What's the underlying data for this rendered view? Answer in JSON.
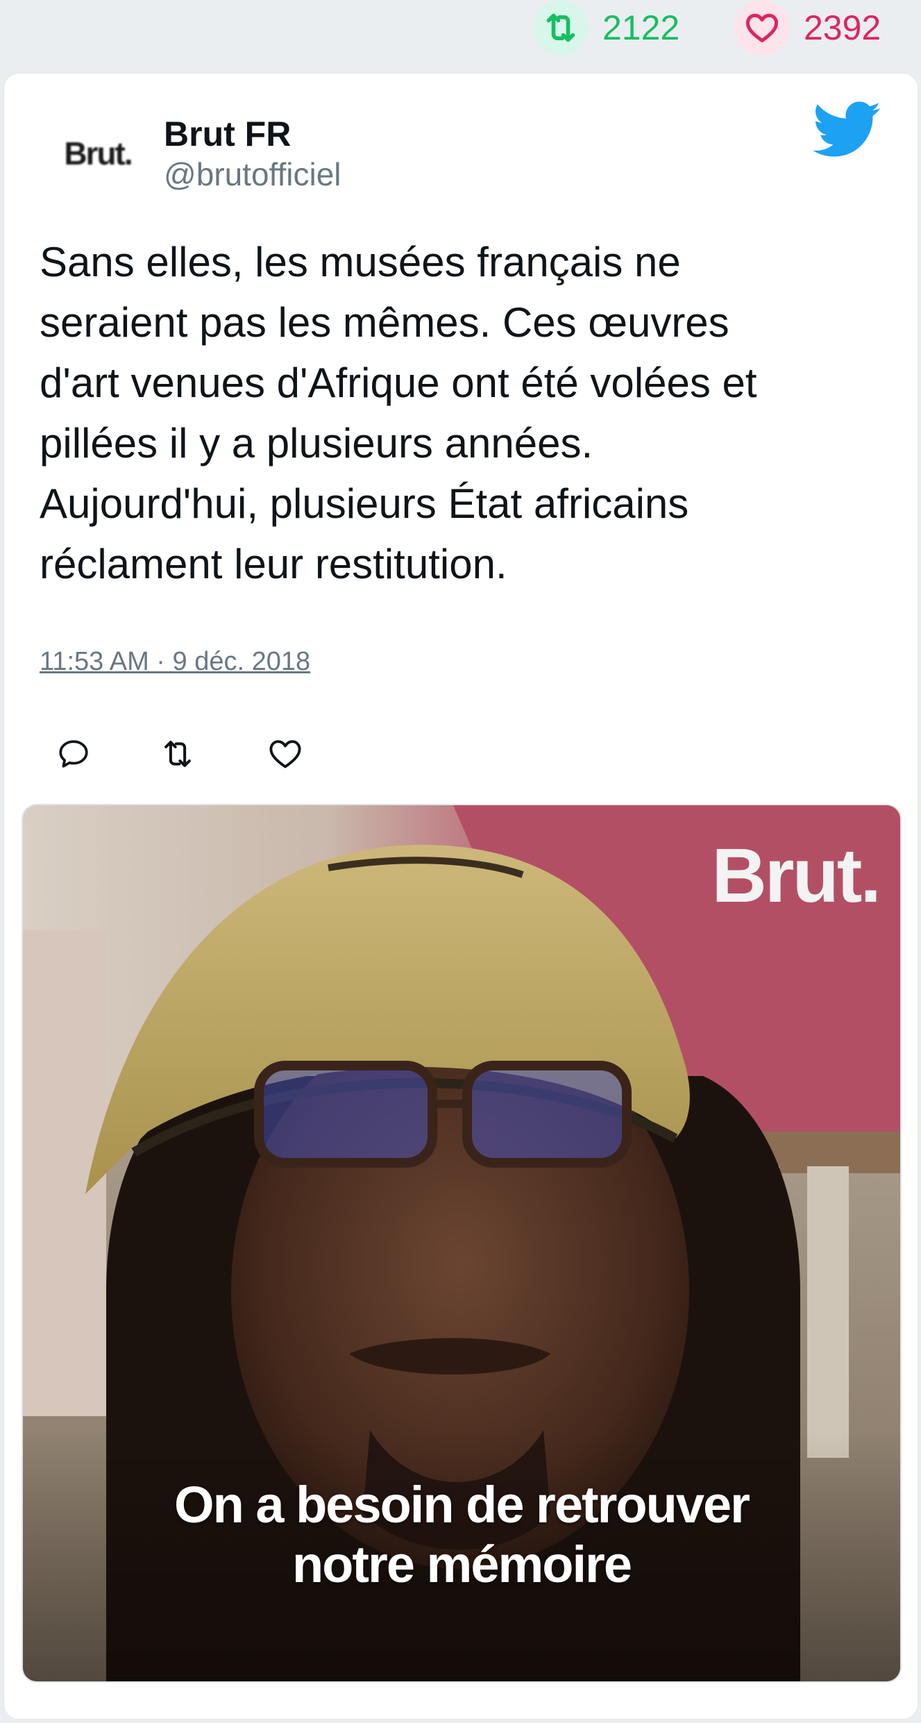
{
  "stats": {
    "retweets": "2122",
    "likes": "2392"
  },
  "tweet": {
    "avatar_text": "Brut.",
    "display_name": "Brut FR",
    "handle": "@brutofficiel",
    "text": "Sans elles, les musées français ne\nseraient pas les mêmes. Ces œuvres\nd'art venues d'Afrique ont été volées et\npillées il y a plusieurs années.\nAujourd'hui, plusieurs État africains\nréclament leur restitution.",
    "timestamp": "11:53 AM · 9 déc. 2018"
  },
  "media": {
    "watermark": "Brut.",
    "caption": "On a besoin de retrouver\nnotre mémoire"
  },
  "icons": {
    "retweet_stat": "retweet-icon",
    "like_stat": "heart-icon",
    "brand": "twitter-bird-icon",
    "reply": "reply-icon",
    "retweet": "retweet-icon",
    "like": "heart-icon"
  },
  "colors": {
    "retweet": "#17bf63",
    "like": "#e0245e",
    "twitter_blue": "#1da1f2",
    "muted": "#697882"
  }
}
